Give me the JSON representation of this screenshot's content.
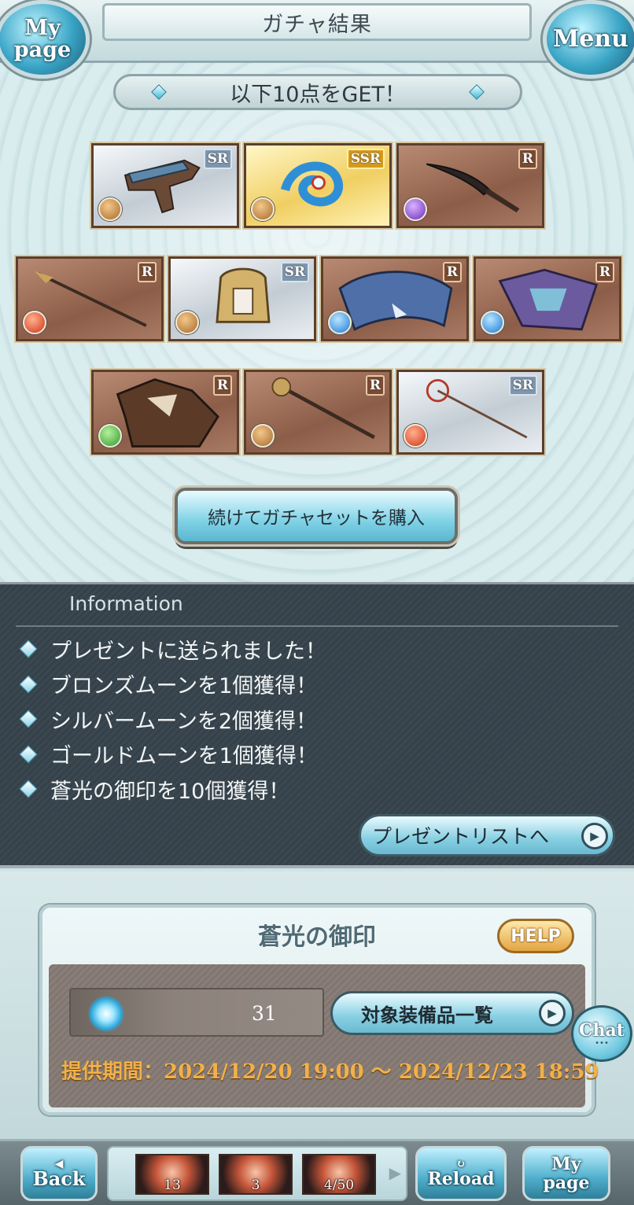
{
  "header": {
    "title": "ガチャ結果",
    "mypage_label_1": "My",
    "mypage_label_2": "page",
    "menu_label": "Menu"
  },
  "result": {
    "banner": "以下10点をGET！",
    "items": [
      {
        "rarity": "SR",
        "element": "earth",
        "icon": "gun-icon"
      },
      {
        "rarity": "SSR",
        "element": "earth",
        "icon": "water-orb-weapon-icon"
      },
      {
        "rarity": "R",
        "element": "dark",
        "icon": "sword-icon"
      },
      {
        "rarity": "R",
        "element": "fire",
        "icon": "spear-icon"
      },
      {
        "rarity": "SR",
        "element": "earth",
        "icon": "gauntlet-icon"
      },
      {
        "rarity": "R",
        "element": "water",
        "icon": "dragon-summon-icon"
      },
      {
        "rarity": "R",
        "element": "water",
        "icon": "wyvern-summon-icon"
      },
      {
        "rarity": "R",
        "element": "wind",
        "icon": "beast-summon-icon"
      },
      {
        "rarity": "R",
        "element": "earth",
        "icon": "staff-icon"
      },
      {
        "rarity": "SR",
        "element": "fire",
        "icon": "scepter-icon"
      }
    ],
    "buy_again_label": "続けてガチャセットを購入"
  },
  "information": {
    "title": "Information",
    "messages": [
      "プレゼントに送られました！",
      "ブロンズムーンを1個獲得！",
      "シルバームーンを2個獲得！",
      "ゴールドムーンを1個獲得！",
      "蒼光の御印を10個獲得！"
    ],
    "present_list_label": "プレゼントリストへ"
  },
  "seal": {
    "title": "蒼光の御印",
    "help_label": "HELP",
    "count": "31",
    "target_list_label": "対象装備品一覧",
    "period": "提供期間：2024/12/20 19:00 〜 2024/12/23 18:59"
  },
  "chat": {
    "label": "Chat"
  },
  "footer": {
    "back_label": "Back",
    "reload_label": "Reload",
    "mypage_label_1": "My",
    "mypage_label_2": "page",
    "resources": [
      "13",
      "3",
      "4/50"
    ]
  },
  "colors": {
    "accent": "#6ab9d0",
    "period_text": "#f1b04a",
    "info_bg": "#3b4850"
  }
}
